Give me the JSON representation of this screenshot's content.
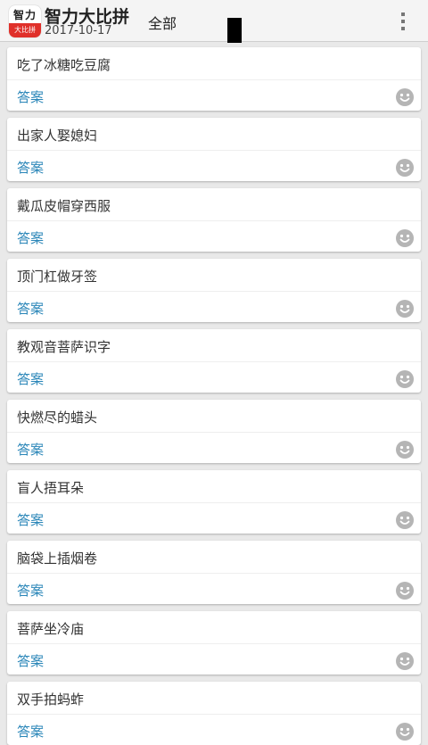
{
  "header": {
    "logo": {
      "top": "智力",
      "bottom": "大比拼"
    },
    "title": "智力大比拼",
    "date": "2017-10-17",
    "category": "全部"
  },
  "items": [
    {
      "question": "吃了冰糖吃豆腐",
      "answer_label": "答案"
    },
    {
      "question": "出家人娶媳妇",
      "answer_label": "答案"
    },
    {
      "question": "戴瓜皮帽穿西服",
      "answer_label": "答案"
    },
    {
      "question": "顶门杠做牙签",
      "answer_label": "答案"
    },
    {
      "question": "教观音菩萨识字",
      "answer_label": "答案"
    },
    {
      "question": "快燃尽的蜡头",
      "answer_label": "答案"
    },
    {
      "question": "盲人捂耳朵",
      "answer_label": "答案"
    },
    {
      "question": "脑袋上插烟卷",
      "answer_label": "答案"
    },
    {
      "question": "菩萨坐冷庙",
      "answer_label": "答案"
    },
    {
      "question": "双手拍蚂蚱",
      "answer_label": "答案"
    }
  ],
  "colors": {
    "answer": "#2a86b8",
    "icon": "#b5b5b5"
  }
}
